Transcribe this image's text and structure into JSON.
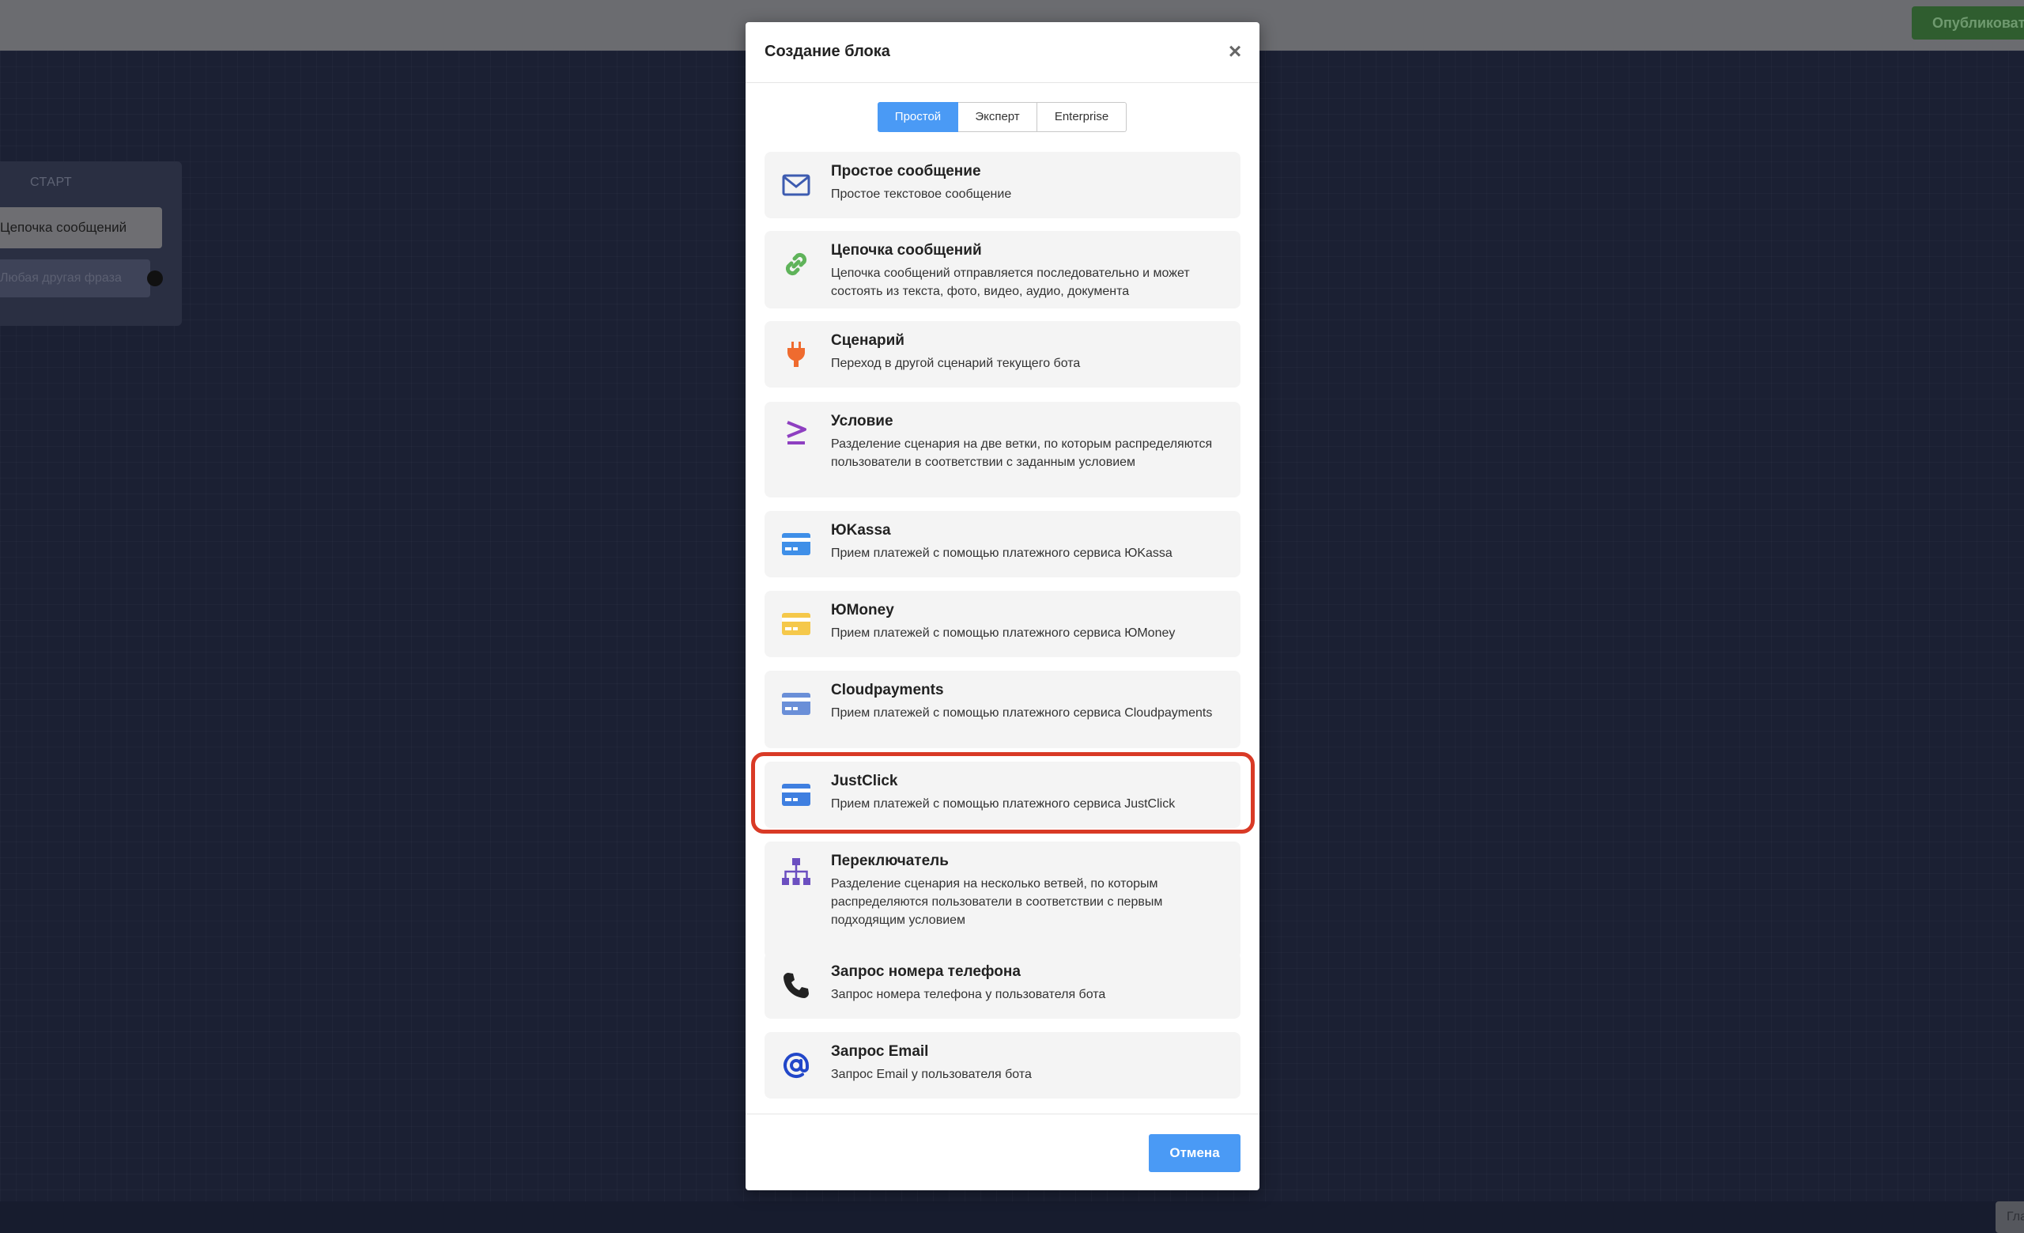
{
  "topbar": {
    "publish_label": "Опубликовать"
  },
  "canvas": {
    "start_title": "СТАРТ",
    "start_chain": "Цепочка сообщений",
    "start_phrase": "Любая другая фраза",
    "corner_button": "Гла"
  },
  "modal": {
    "title": "Создание блока",
    "close_symbol": "×",
    "tabs": [
      {
        "label": "Простой",
        "active": true
      },
      {
        "label": "Эксперт",
        "active": false
      },
      {
        "label": "Enterprise",
        "active": false
      }
    ],
    "items": [
      {
        "title": "Простое сообщение",
        "desc": "Простое текстовое сообщение",
        "icon": "envelope-icon",
        "color": "#3d5bb0"
      },
      {
        "title": "Цепочка сообщений",
        "desc": "Цепочка сообщений отправляется последовательно и может состоять из текста, фото, видео, аудио, документа",
        "icon": "link-icon",
        "color": "#5fb35a"
      },
      {
        "title": "Сценарий",
        "desc": "Переход в другой сценарий текущего бота",
        "icon": "plug-icon",
        "color": "#ef6b2f"
      },
      {
        "title": "Условие",
        "desc": "Разделение сценария на две ветки, по которым распределяются пользователи в соответствии с заданным условием",
        "icon": "greater-equal-icon",
        "color": "#8e3fc1"
      },
      {
        "title": "ЮKassa",
        "desc": "Прием платежей с помощью платежного сервиса ЮKassa",
        "icon": "credit-card-icon",
        "color": "#3f8fe8"
      },
      {
        "title": "ЮMoney",
        "desc": "Прием платежей с помощью платежного сервиса ЮMoney",
        "icon": "credit-card-icon",
        "color": "#f5c84a"
      },
      {
        "title": "Cloudpayments",
        "desc": "Прием платежей с помощью платежного сервиса Cloudpayments",
        "icon": "credit-card-icon",
        "color": "#6a8fd8"
      },
      {
        "title": "JustClick",
        "desc": "Прием платежей с помощью платежного сервиса JustClick",
        "icon": "credit-card-icon",
        "color": "#3f7fe0"
      },
      {
        "title": "Переключатель",
        "desc": "Разделение сценария на несколько ветвей, по которым распределяются пользователи в соответствии с первым подходящим условием",
        "icon": "sitemap-icon",
        "color": "#6b4fc0"
      },
      {
        "title": "Запрос номера телефона",
        "desc": "Запрос номера телефона у пользователя бота",
        "icon": "phone-icon",
        "color": "#222222"
      },
      {
        "title": "Запрос Email",
        "desc": "Запрос Email у пользователя бота",
        "icon": "at-icon",
        "color": "#2247c9"
      }
    ],
    "cancel_label": "Отмена"
  }
}
